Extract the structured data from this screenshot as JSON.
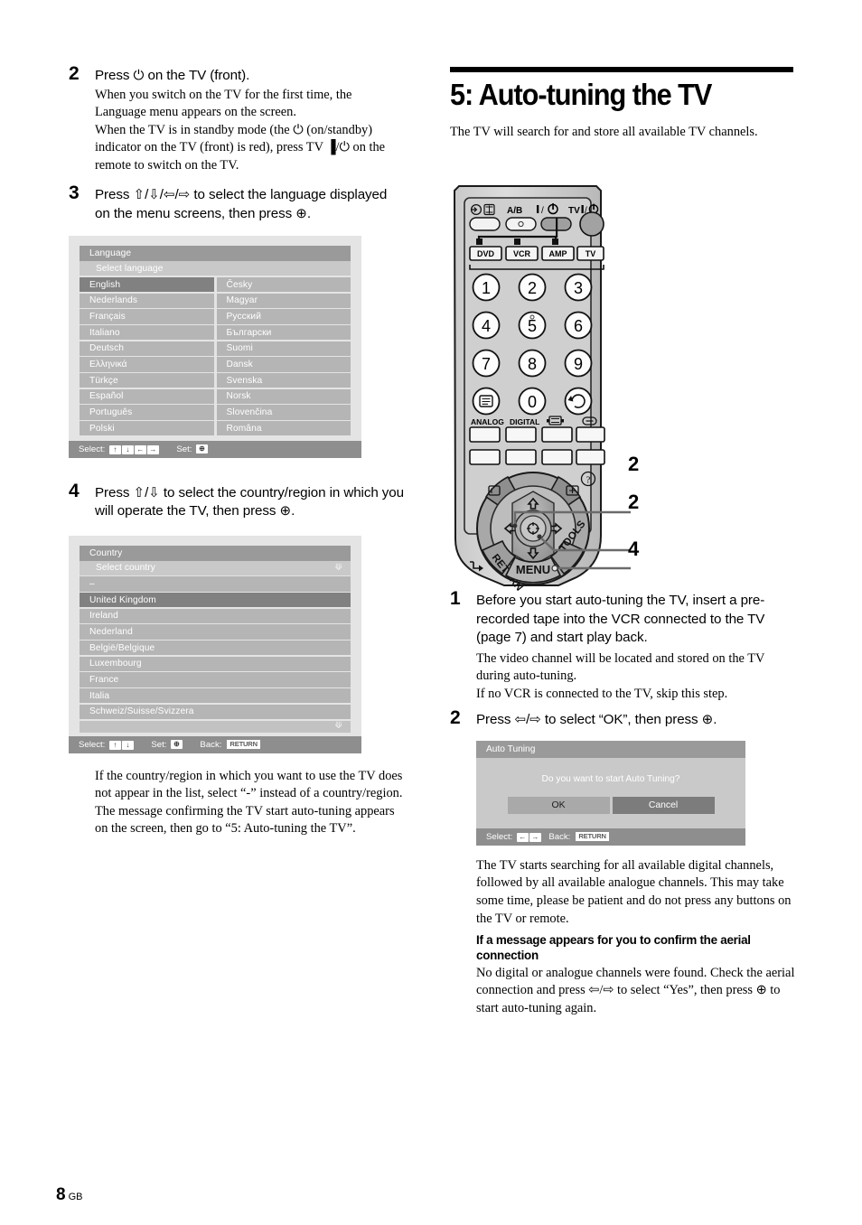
{
  "page": {
    "number": "8",
    "region": "GB"
  },
  "left_column": {
    "step2": {
      "number": "2",
      "heading": "Press ⏻ on the TV (front).",
      "paragraphs": [
        "When you switch on the TV for the first time, the Language menu appears on the screen.",
        "When the TV is in standby mode (the ⏻ (on/standby) indicator on the TV (front) is red), press TV ▐/⏻ on the remote to switch on the TV."
      ]
    },
    "step3": {
      "number": "3",
      "heading": "Press ⇧/⇩/⇦/⇨ to select the language displayed on the menu screens, then press ⊕."
    },
    "language_menu": {
      "title": "Language",
      "subtitle": "Select language",
      "selected": "English",
      "column_left": [
        "English",
        "Nederlands",
        "Français",
        "Italiano",
        "Deutsch",
        "Ελληνικά",
        "Türkçe",
        "Español",
        "Português",
        "Polski"
      ],
      "column_right": [
        "Česky",
        "Magyar",
        "Русский",
        "Български",
        "Suomi",
        "Dansk",
        "Svenska",
        "Norsk",
        "Slovenčina",
        "Româna"
      ],
      "footer": {
        "select_label": "Select:",
        "set_label": "Set:",
        "keys": [
          "↑",
          "↓",
          "←",
          "→"
        ],
        "set_key": "⊕"
      }
    },
    "step4": {
      "number": "4",
      "heading": "Press ⇧/⇩ to select the country/region in which you will operate the TV, then press ⊕."
    },
    "country_menu": {
      "title": "Country",
      "subtitle": "Select country",
      "selected": "United Kingdom",
      "items": [
        "–",
        "United Kingdom",
        "Ireland",
        "Nederland",
        "België/Belgique",
        "Luxembourg",
        "France",
        "Italia",
        "Schweiz/Suisse/Svizzera"
      ],
      "footer": {
        "select_label": "Select:",
        "set_label": "Set:",
        "back_label": "Back:",
        "keys": [
          "↑",
          "↓"
        ],
        "set_key": "⊕",
        "back_key": "RETURN"
      }
    },
    "closing_paragraphs": [
      "If the country/region in which you want to use the TV does not appear in the list, select “-” instead of a country/region.",
      "The message confirming the TV start auto-tuning appears on the screen, then go to “5: Auto-tuning the TV”."
    ]
  },
  "right_column": {
    "section_title": "5: Auto-tuning the TV",
    "section_intro": "The TV will search for and store all available TV channels.",
    "remote": {
      "top_labels": {
        "ab": "A/B",
        "power": "▐ / ⏻",
        "tv_power": "TV▐ / ⏻"
      },
      "mode_buttons": [
        "DVD",
        "VCR",
        "AMP",
        "TV"
      ],
      "numeric_keys": [
        "1",
        "2",
        "3",
        "4",
        "5",
        "6",
        "7",
        "8",
        "9",
        "0"
      ],
      "function_labels": [
        "ANALOG",
        "DIGITAL"
      ],
      "pad_labels": {
        "return": "RETURN",
        "tools": "TOOLS",
        "menu": "MENU"
      },
      "callouts": [
        "2",
        "2",
        "4"
      ]
    },
    "step1": {
      "number": "1",
      "heading": "Before you start auto-tuning the TV, insert a pre-recorded tape into the VCR connected to the TV (page 7) and start play back.",
      "paragraphs": [
        "The video channel will be located and stored on the TV during auto-tuning.",
        "If no VCR is connected to the TV, skip this step."
      ]
    },
    "step2": {
      "number": "2",
      "heading": "Press ⇦/⇨ to select “OK”, then press ⊕."
    },
    "auto_tuning_dialog": {
      "title": "Auto Tuning",
      "message": "Do you want to start Auto Tuning?",
      "ok_label": "OK",
      "cancel_label": "Cancel",
      "footer": {
        "select_label": "Select:",
        "back_label": "Back:",
        "keys": [
          "←",
          "→"
        ],
        "back_key": "RETURN"
      }
    },
    "closing_paragraph": "The TV starts searching for all available digital channels, followed by all available analogue channels. This may take some time, please be patient and do not press any buttons on the TV or remote.",
    "aerial_heading": "If a message appears for you to confirm the aerial connection",
    "aerial_paragraph": "No digital or analogue channels were found. Check the aerial connection and press ⇦/⇨ to select “Yes”, then press ⊕ to start auto-tuning again."
  }
}
